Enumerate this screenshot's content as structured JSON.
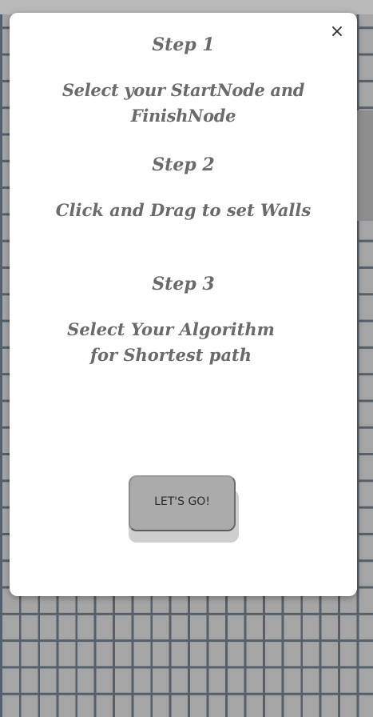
{
  "tutorial": {
    "close_glyph": "×",
    "steps": [
      {
        "title": "Step 1",
        "description": "Select your StartNode and FinishNode"
      },
      {
        "title": "Step 2",
        "description": "Click and Drag to set Walls"
      },
      {
        "title": "Step 3",
        "description": "Select Your Algorithm for Shortest path"
      }
    ],
    "go_button_label": "LET'S GO!"
  },
  "colors": {
    "grid_cell": "#a5a5a5",
    "grid_line": "#55606a",
    "modal_bg": "#ffffff",
    "step_text": "#6a6a6a",
    "button_bg": "#ababab"
  }
}
